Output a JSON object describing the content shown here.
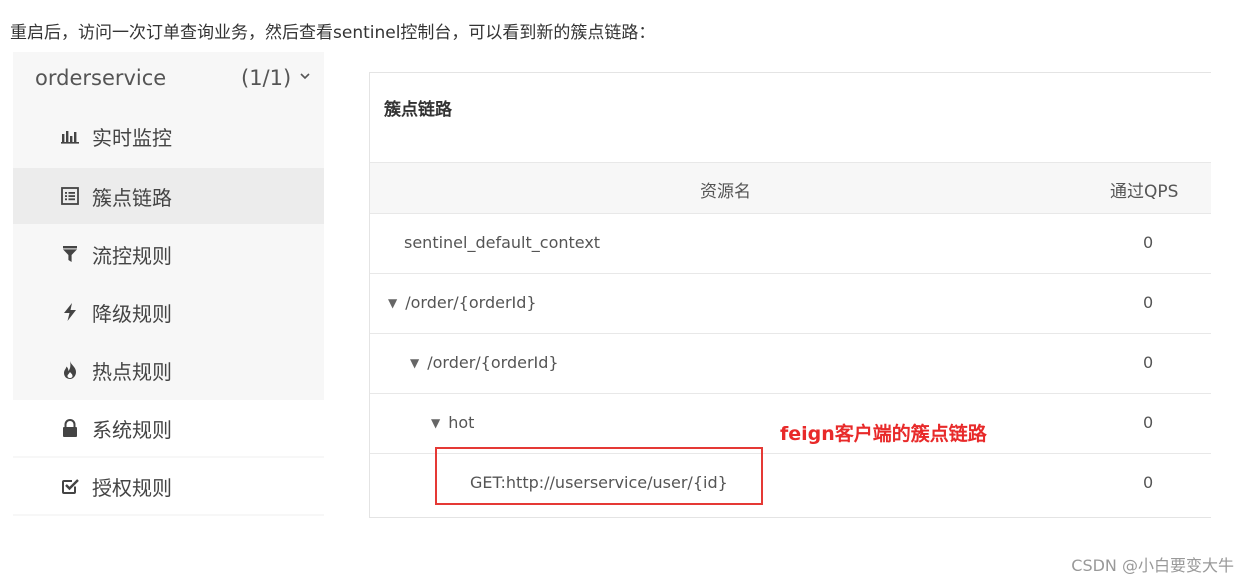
{
  "intro_text": "重启后，访问一次订单查询业务，然后查看sentinel控制台，可以看到新的簇点链路：",
  "sidebar": {
    "app_name": "orderservice",
    "app_count": "(1/1)",
    "items": [
      {
        "label": "实时监控",
        "icon": "bar-chart-icon"
      },
      {
        "label": "簇点链路",
        "icon": "list-icon",
        "active": true
      },
      {
        "label": "流控规则",
        "icon": "filter-icon"
      },
      {
        "label": "降级规则",
        "icon": "bolt-icon"
      },
      {
        "label": "热点规则",
        "icon": "fire-icon"
      },
      {
        "label": "系统规则",
        "icon": "lock-icon"
      },
      {
        "label": "授权规则",
        "icon": "check-square-icon"
      }
    ]
  },
  "panel": {
    "title": "簇点链路",
    "columns": {
      "name": "资源名",
      "qps": "通过QPS"
    },
    "rows": [
      {
        "name": "sentinel_default_context",
        "qps": "0",
        "expandable": false
      },
      {
        "name": "/order/{orderId}",
        "qps": "0",
        "expandable": true
      },
      {
        "name": "/order/{orderId}",
        "qps": "0",
        "expandable": true
      },
      {
        "name": "hot",
        "qps": "0",
        "expandable": true
      },
      {
        "name": "GET:http://userservice/user/{id}",
        "qps": "0",
        "expandable": false
      }
    ]
  },
  "annotation": "feign客户端的簇点链路",
  "annotation_color": "#e82a2a",
  "watermark": "CSDN @小白要变大牛"
}
